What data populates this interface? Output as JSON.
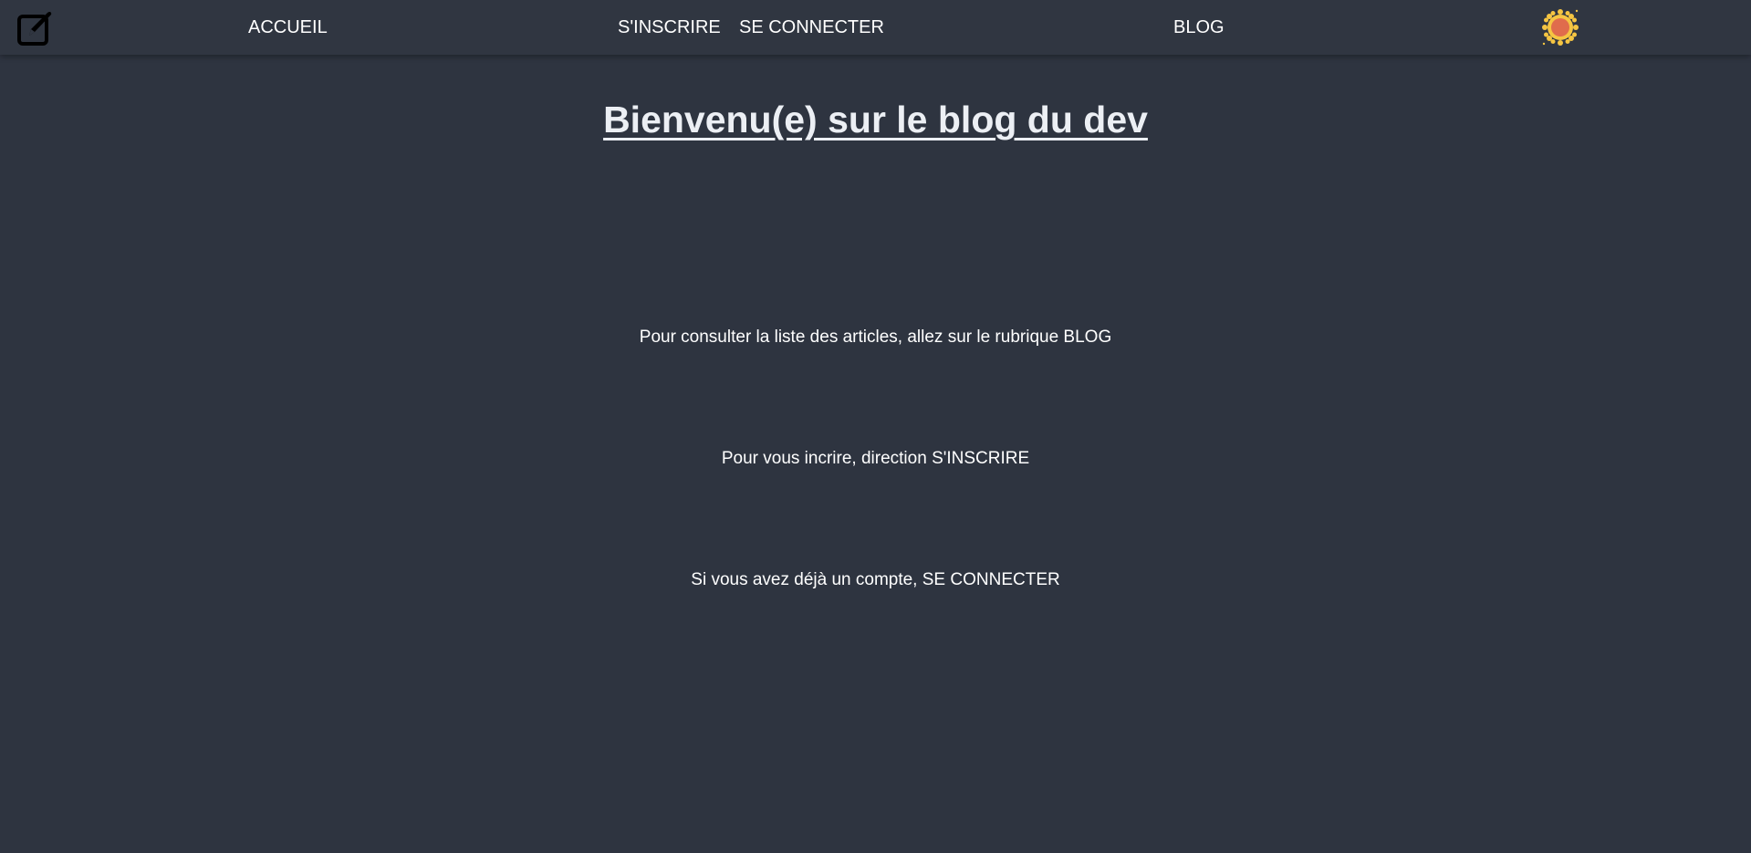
{
  "nav": {
    "logo_icon": "edit-pen-icon",
    "home": "ACCUEIL",
    "signup": "S'INSCRIRE",
    "login": "SE CONNECTER",
    "blog": "BLOG",
    "theme_icon": "sun-icon"
  },
  "main": {
    "title": "Bienvenu(e) sur le blog du dev",
    "lines": [
      {
        "text": "Pour consulter la liste des articles, allez sur le rubrique ",
        "link": "BLOG"
      },
      {
        "text": "Pour vous incrire, direction ",
        "link": "S'INSCRIRE"
      },
      {
        "text": "Si vous avez déjà un compte, ",
        "link": "SE CONNECTER"
      }
    ]
  },
  "colors": {
    "background": "#2e3440",
    "navbar": "#303641",
    "text": "#ffffff",
    "sun_outer": "#f5c542",
    "sun_inner": "#e06c4c"
  }
}
